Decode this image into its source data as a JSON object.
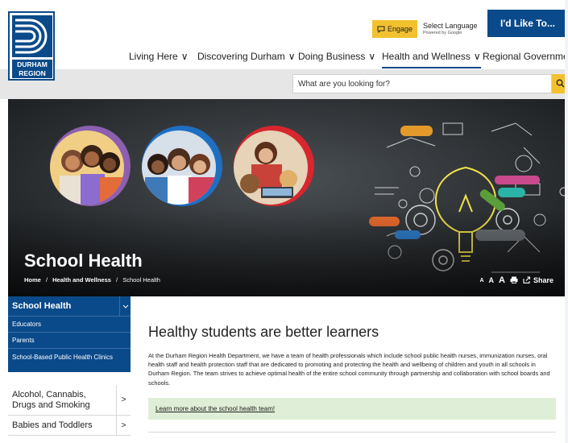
{
  "header": {
    "logo_text_line1": "DURHAM",
    "logo_text_line2": "REGION",
    "engage_label": "Engage",
    "language": {
      "label": "Select Language",
      "powered_by": "Powered by Google"
    },
    "cta_label": "I'd Like To...",
    "nav": [
      {
        "label": "Living Here"
      },
      {
        "label": "Discovering Durham"
      },
      {
        "label": "Doing Business"
      },
      {
        "label": "Health and Wellness"
      },
      {
        "label": "Regional Government"
      }
    ],
    "chevron": "∨"
  },
  "search": {
    "placeholder": "What are you looking for?"
  },
  "hero": {
    "title": "School Health",
    "breadcrumb": {
      "home": "Home",
      "separator": "/",
      "section": "Health and Wellness",
      "current": "School Health"
    },
    "text_size_small": "A",
    "text_size_medium": "A",
    "text_size_large": "A",
    "share_label": "Share",
    "chalk_words": [
      "Thinking",
      "Engineering",
      "Invent",
      "Knowledge",
      "Learning",
      "Study",
      "Innovation",
      "Solution",
      "ecology",
      "Science"
    ]
  },
  "sidebar": {
    "heading": "School Health",
    "sub_items": [
      {
        "label": "Educators"
      },
      {
        "label": "Parents"
      },
      {
        "label": "School-Based Public Health Clinics"
      }
    ],
    "items": [
      {
        "label": "Alcohol, Cannabis, Drugs and Smoking"
      },
      {
        "label": "Babies and Toddlers"
      }
    ],
    "arrow": ">"
  },
  "content": {
    "title": "Healthy students are better learners",
    "body": "At the Durham Region Health Department, we have a team of health professionals which include school public health nurses, immunization nurses, oral health staff and health protection staff that are dedicated to promoting and protecting the health and wellbeing of children and youth in all schools in Durham Region. The team strives to achieve optimal health of the entire school community through partnership and collaboration with school boards and schools.",
    "learn_more": "Learn more about the school health team!"
  },
  "colors": {
    "brand_blue": "#0a4a8a",
    "accent_yellow": "#f2c12e",
    "learn_green": "#dfeed6",
    "ring_purple": "#8c5fb0",
    "ring_blue": "#1e6fc2",
    "ring_red": "#d8262f"
  },
  "icons": [
    "engage-icon",
    "search-icon",
    "print-icon",
    "share-icon",
    "chevron-down-icon",
    "chevron-right-icon"
  ]
}
